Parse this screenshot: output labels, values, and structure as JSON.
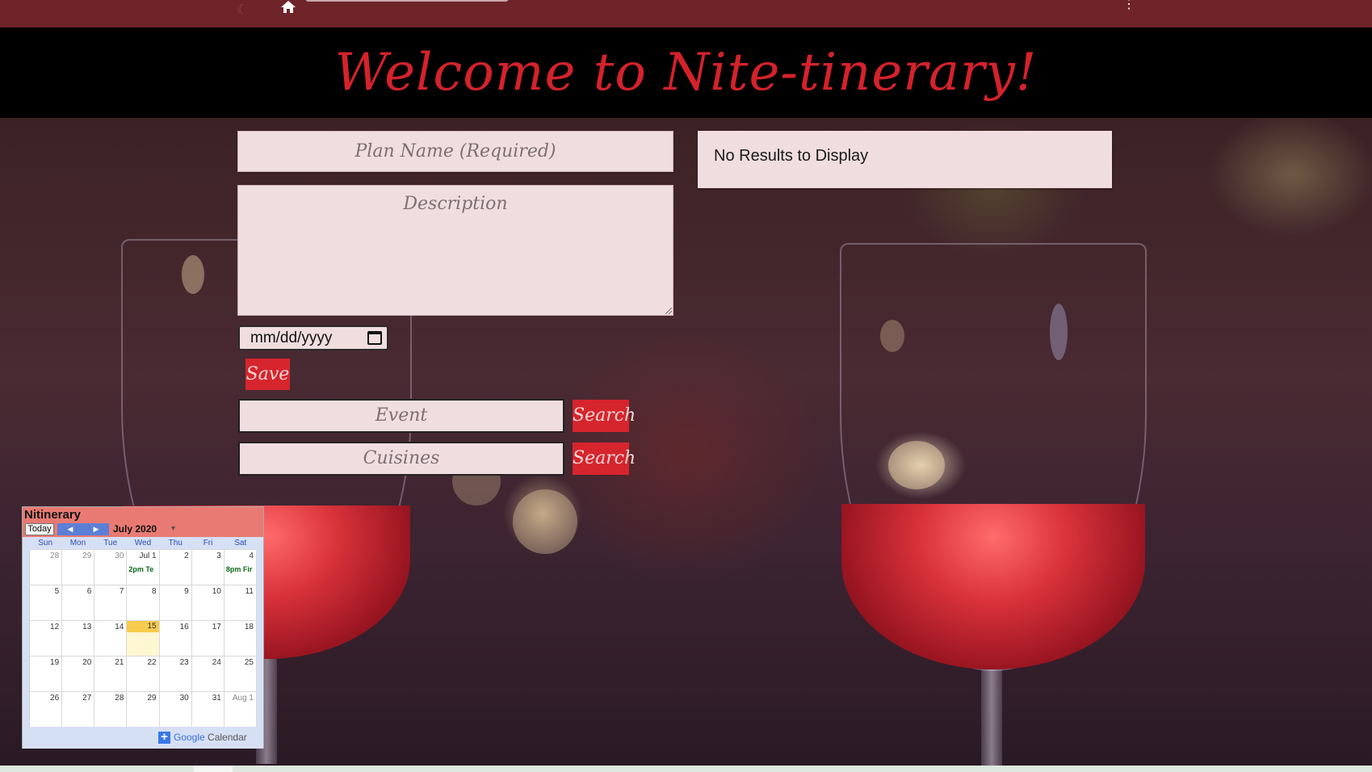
{
  "header": {
    "title": "Welcome to Nite-tinerary!"
  },
  "form": {
    "plan_name_placeholder": "Plan Name (Required)",
    "description_placeholder": "Description",
    "date_placeholder": "mm/dd/yyyy",
    "save_label": "Save",
    "event_placeholder": "Event",
    "cuisines_placeholder": "Cuisines",
    "search_label": "Search"
  },
  "results": {
    "message": "No Results to Display"
  },
  "calendar": {
    "title": "Nitinerary",
    "today_label": "Today",
    "month_label": "July 2020",
    "dow": [
      "Sun",
      "Mon",
      "Tue",
      "Wed",
      "Thu",
      "Fri",
      "Sat"
    ],
    "weeks": [
      [
        "28",
        "29",
        "30",
        "Jul 1",
        "2",
        "3",
        "4"
      ],
      [
        "5",
        "6",
        "7",
        "8",
        "9",
        "10",
        "11"
      ],
      [
        "12",
        "13",
        "14",
        "15",
        "16",
        "17",
        "18"
      ],
      [
        "19",
        "20",
        "21",
        "22",
        "23",
        "24",
        "25"
      ],
      [
        "26",
        "27",
        "28",
        "29",
        "30",
        "31",
        "Aug 1"
      ]
    ],
    "events": {
      "wed_jul1": "2pm Te",
      "sat_jul4": "8pm Fir"
    },
    "today": "15",
    "footer_google": "Google",
    "footer_calendar": "Calendar"
  },
  "colors": {
    "topbar": "#6f2429",
    "accent_red": "#d6252d",
    "field_bg": "#f0dde0",
    "calendar_header": "#e87a73"
  }
}
